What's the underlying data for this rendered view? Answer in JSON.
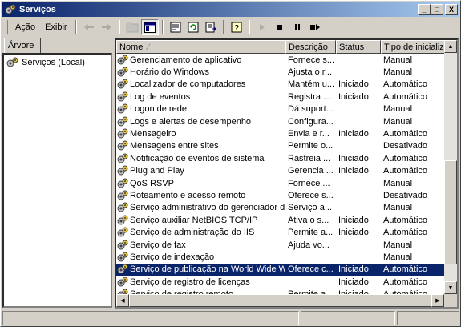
{
  "window": {
    "title": "Serviços",
    "minimize": "_",
    "maximize": "□",
    "close": "X"
  },
  "menubar": {
    "items": [
      "Ação",
      "Exibir"
    ]
  },
  "toolbar": {
    "buttons": [
      "back-icon",
      "forward-icon",
      "up-folder-icon",
      "show-hide-tree-icon",
      "properties-icon",
      "refresh-icon",
      "export-list-icon",
      "help-icon",
      "start-icon",
      "stop-icon",
      "pause-icon",
      "restart-icon"
    ]
  },
  "tree": {
    "tab_label": "Árvore",
    "root": "Serviços (Local)"
  },
  "table": {
    "columns": [
      "Nome",
      "Descrição",
      "Status",
      "Tipo de inicializaçã"
    ],
    "rows": [
      {
        "name": "Gerenciamento de aplicativo",
        "desc": "Fornece s...",
        "status": "",
        "type": "Manual"
      },
      {
        "name": "Horário do Windows",
        "desc": "Ajusta o r...",
        "status": "",
        "type": "Manual"
      },
      {
        "name": "Localizador de computadores",
        "desc": "Mantém u...",
        "status": "Iniciado",
        "type": "Automático"
      },
      {
        "name": "Log de eventos",
        "desc": "Registra ...",
        "status": "Iniciado",
        "type": "Automático"
      },
      {
        "name": "Logon de rede",
        "desc": "Dá suport...",
        "status": "",
        "type": "Manual"
      },
      {
        "name": "Logs e alertas de desempenho",
        "desc": "Configura...",
        "status": "",
        "type": "Manual"
      },
      {
        "name": "Mensageiro",
        "desc": "Envia e r...",
        "status": "Iniciado",
        "type": "Automático"
      },
      {
        "name": "Mensagens entre sites",
        "desc": "Permite o...",
        "status": "",
        "type": "Desativado"
      },
      {
        "name": "Notificação de eventos de sistema",
        "desc": "Rastreia ...",
        "status": "Iniciado",
        "type": "Automático"
      },
      {
        "name": "Plug and Play",
        "desc": "Gerencia ...",
        "status": "Iniciado",
        "type": "Automático"
      },
      {
        "name": "QoS RSVP",
        "desc": "Fornece ...",
        "status": "",
        "type": "Manual"
      },
      {
        "name": "Roteamento e acesso remoto",
        "desc": "Oferece s...",
        "status": "",
        "type": "Desativado"
      },
      {
        "name": "Serviço administrativo do gerenciador de ...",
        "desc": "Serviço a...",
        "status": "",
        "type": "Manual"
      },
      {
        "name": "Serviço auxiliar NetBIOS TCP/IP",
        "desc": "Ativa o s...",
        "status": "Iniciado",
        "type": "Automático"
      },
      {
        "name": "Serviço de administração do IIS",
        "desc": "Permite a...",
        "status": "Iniciado",
        "type": "Automático"
      },
      {
        "name": "Serviço de fax",
        "desc": "Ajuda vo...",
        "status": "",
        "type": "Manual"
      },
      {
        "name": "Serviço de indexação",
        "desc": "",
        "status": "",
        "type": "Manual"
      },
      {
        "name": "Serviço de publicação na World Wide Web",
        "desc": "Oferece c...",
        "status": "Iniciado",
        "type": "Automático"
      },
      {
        "name": "Serviço de registro de licenças",
        "desc": "",
        "status": "Iniciado",
        "type": "Automático"
      },
      {
        "name": "Serviço de registro remoto",
        "desc": "Permite a...",
        "status": "Iniciado",
        "type": "Automático"
      }
    ],
    "selected_row": "Serviço de publicação na World Wide Web"
  },
  "colors": {
    "selection": "#0a246a",
    "title_start": "#0a246a",
    "title_end": "#a6caf0"
  }
}
